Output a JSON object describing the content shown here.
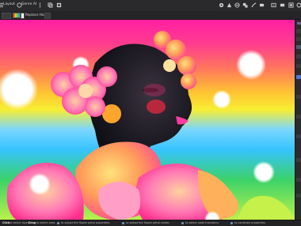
{
  "toolbar": {
    "layout_label": "Layout",
    "persona_label": "Genre AI"
  },
  "context_bar": {
    "mode_label": "Replace Hand"
  },
  "status_bar": {
    "items": [
      "Click",
      "to select layer.",
      "Drag",
      "to select area.",
      "to adjust the flower petal properties.",
      "to adjust the flower petal center.",
      "to select node transform.",
      "to constrain properties."
    ]
  },
  "colors": {
    "background_gradient": [
      "#ff1fa2",
      "#ff3c8f",
      "#ff7a5a",
      "#ffc233",
      "#f7ee33",
      "#7ad6ff",
      "#36c3ff",
      "#3bd26a",
      "#b9f24a"
    ],
    "accent": "#5a6e8c"
  }
}
